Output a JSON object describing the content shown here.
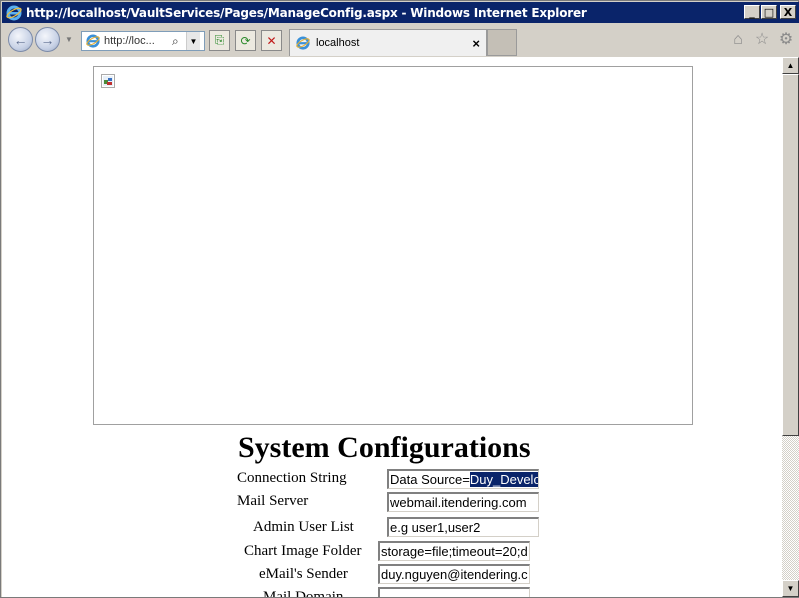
{
  "window": {
    "title": "http://localhost/VaultServices/Pages/ManageConfig.aspx - Windows Internet Explorer",
    "minimize_glyph": "_",
    "maximize_glyph": "□",
    "close_glyph": "X"
  },
  "toolbar": {
    "back_glyph": "←",
    "forward_glyph": "→",
    "address_text": "http://loc...",
    "search_glyph": "⌕",
    "dropdown_glyph": "▼",
    "compat_glyph": "⎘",
    "refresh_glyph": "⟳",
    "stop_glyph": "✕"
  },
  "tabs": [
    {
      "label": "localhost",
      "close_glyph": "×"
    }
  ],
  "icons": {
    "home": "⌂",
    "favorites": "☆",
    "tools": "⚙"
  },
  "page": {
    "heading": "System Configurations",
    "rows": [
      {
        "label": "Connection String",
        "value_plain": "Data Source=",
        "value_selected": "Duy_Develo"
      },
      {
        "label": "Mail Server",
        "value": "webmail.itendering.com"
      },
      {
        "label": "Admin User List",
        "value": "e.g user1,user2"
      },
      {
        "label": "Chart Image Folder",
        "value": "storage=file;timeout=20;d"
      },
      {
        "label": "eMail's Sender",
        "value": "duy.nguyen@itendering.c"
      },
      {
        "label": "Mail Domain",
        "value": ""
      }
    ]
  },
  "colors": {
    "titlebar": "#0a246a",
    "selection": "#0a246a",
    "chrome": "#d4d0c8"
  }
}
